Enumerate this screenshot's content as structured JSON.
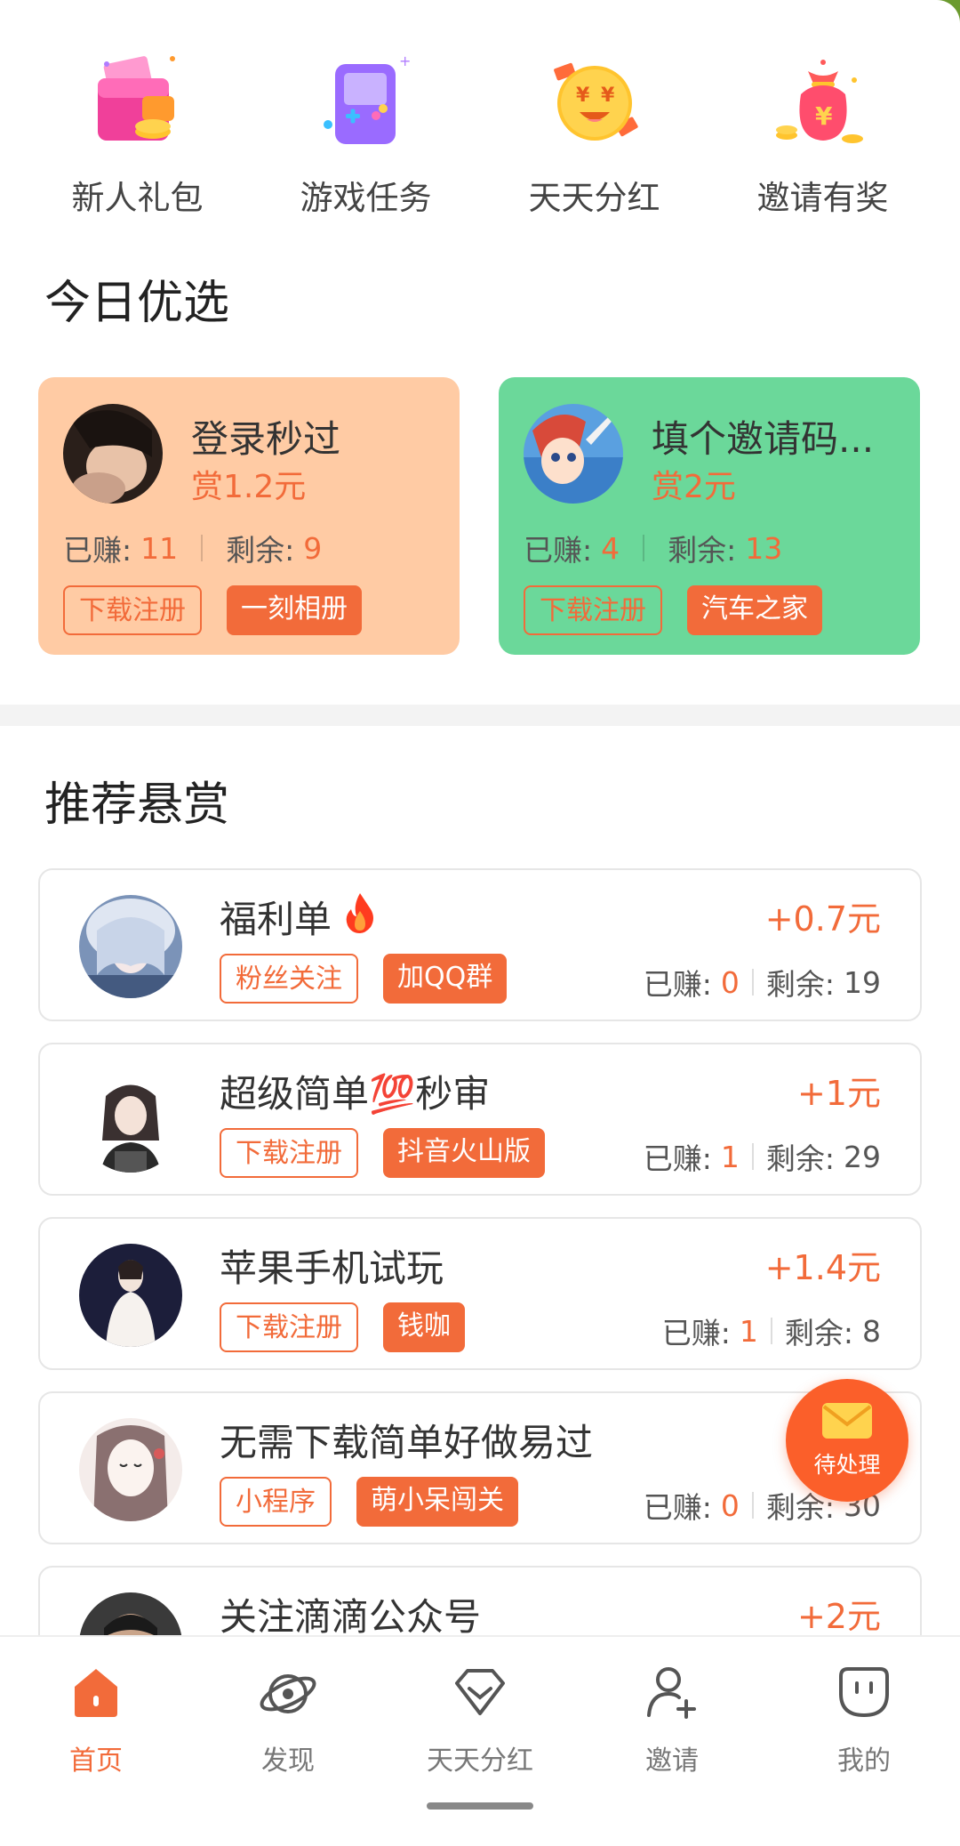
{
  "quick_links": [
    {
      "label": "新人礼包",
      "icon": "gift-wallet-icon"
    },
    {
      "label": "游戏任务",
      "icon": "game-console-icon"
    },
    {
      "label": "天天分红",
      "icon": "money-emoji-icon"
    },
    {
      "label": "邀请有奖",
      "icon": "money-bag-icon"
    }
  ],
  "today": {
    "title": "今日优选",
    "cards": [
      {
        "title": "登录秒过",
        "reward": "赏1.2元",
        "earned_label": "已赚:",
        "earned": "11",
        "remaining_label": "剩余:",
        "remaining": "9",
        "tag1": "下载注册",
        "tag2": "一刻相册",
        "bg": "#ffcba4"
      },
      {
        "title": "填个邀请码...",
        "reward": "赏2元",
        "earned_label": "已赚:",
        "earned": "4",
        "remaining_label": "剩余:",
        "remaining": "13",
        "tag1": "下载注册",
        "tag2": "汽车之家",
        "bg": "#6bd89a"
      }
    ]
  },
  "recommend": {
    "title": "推荐悬赏",
    "items": [
      {
        "title": "福利单",
        "emoji": "🔥",
        "amount": "+0.7元",
        "tag1": "粉丝关注",
        "tag2": "加QQ群",
        "earned_label": "已赚:",
        "earned": "0",
        "remaining_label": "剩余:",
        "remaining": "19"
      },
      {
        "title": "超级简单💯秒审",
        "emoji": "",
        "amount": "+1元",
        "tag1": "下载注册",
        "tag2": "抖音火山版",
        "earned_label": "已赚:",
        "earned": "1",
        "remaining_label": "剩余:",
        "remaining": "29"
      },
      {
        "title": "苹果手机试玩",
        "emoji": "",
        "amount": "+1.4元",
        "tag1": "下载注册",
        "tag2": "钱咖",
        "earned_label": "已赚:",
        "earned": "1",
        "remaining_label": "剩余:",
        "remaining": "8"
      },
      {
        "title": "无需下载简单好做易过",
        "emoji": "",
        "amount": "+",
        "tag1": "小程序",
        "tag2": "萌小呆闯关",
        "earned_label": "已赚:",
        "earned": "0",
        "remaining_label": "剩余:",
        "remaining": "30"
      },
      {
        "title": "关注滴滴公众号",
        "emoji": "",
        "amount": "+2元",
        "tag1": "",
        "tag2": "",
        "earned_label": "",
        "earned": "",
        "remaining_label": "",
        "remaining": ""
      }
    ]
  },
  "fab": {
    "label": "待处理",
    "icon": "mail-icon"
  },
  "nav": [
    {
      "label": "首页",
      "icon": "home-icon",
      "active": true
    },
    {
      "label": "发现",
      "icon": "planet-icon",
      "active": false
    },
    {
      "label": "天天分红",
      "icon": "gem-icon",
      "active": false
    },
    {
      "label": "邀请",
      "icon": "add-user-icon",
      "active": false
    },
    {
      "label": "我的",
      "icon": "profile-face-icon",
      "active": false
    }
  ],
  "colors": {
    "accent": "#f26b3a",
    "peach": "#ffcba4",
    "green": "#6bd89a",
    "fab": "#fb5f2a"
  }
}
